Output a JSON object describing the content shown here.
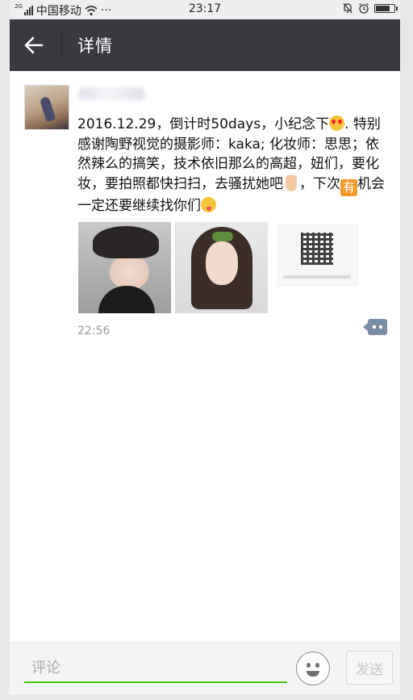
{
  "status_bar": {
    "network_type": "2G",
    "carrier": "中国移动",
    "more": "···",
    "time": "23:17",
    "battery_level_percent": 85
  },
  "nav": {
    "title": "详情"
  },
  "post": {
    "text_part1": "2016.12.29，倒计时50days，小纪念下",
    "text_part2": ". 特别感谢陶野视觉的摄影师：kaka; 化妆师：思思；依然辣么的搞笑，技术依旧那么的高超，妞们，要化妆，要拍照都快扫扫，去骚扰她吧",
    "text_part3": "，下次",
    "text_part4": "机会一定还要继续找你们",
    "emoji_you_char": "有",
    "time": "22:56"
  },
  "comment_bar": {
    "placeholder": "评论",
    "send_label": "发送"
  },
  "icons": {
    "back": "arrow-left-icon",
    "comment": "comment-more-icon",
    "emoji": "smiley-icon"
  },
  "colors": {
    "nav_bg": "#393a3f",
    "input_underline": "#45c01a",
    "comment_icon": "#7b8ca6"
  }
}
